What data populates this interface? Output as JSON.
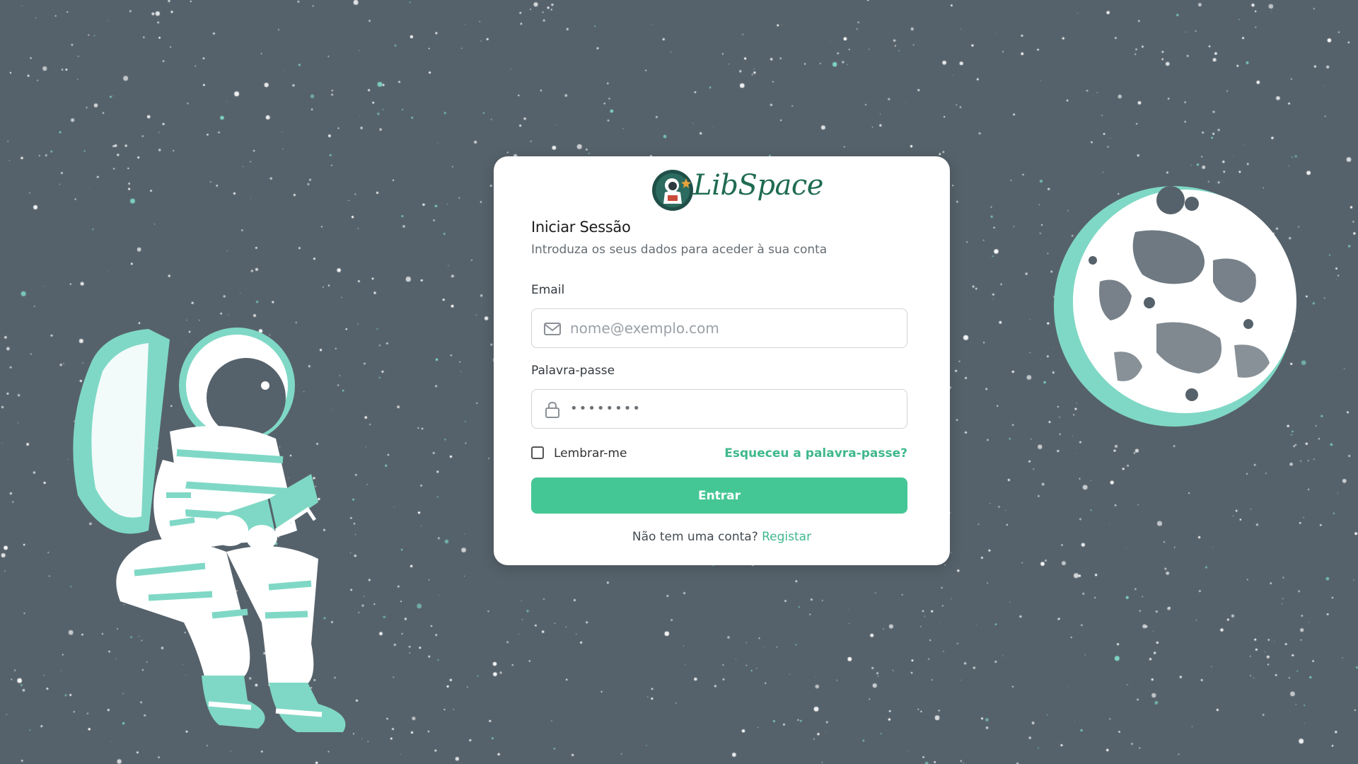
{
  "brand": {
    "name": "LibSpace"
  },
  "login": {
    "title": "Iniciar Sessão",
    "subtitle": "Introduza os seus dados para aceder à sua conta",
    "email_label": "Email",
    "email_placeholder": "nome@exemplo.com",
    "password_label": "Palavra-passe",
    "password_value": "••••••••",
    "remember_label": "Lembrar-me",
    "remember_checked": false,
    "forgot_label": "Esqueceu a palavra-passe?",
    "submit_label": "Entrar",
    "signup_prompt": "Não tem uma conta?",
    "signup_link": "Registar"
  },
  "icons": {
    "email": "mail-icon",
    "password": "lock-icon"
  },
  "colors": {
    "background": "#56626b",
    "accent": "#45c795",
    "link": "#3fb88c",
    "mint": "#7fd8c5",
    "brand_text": "#1f6b50"
  }
}
